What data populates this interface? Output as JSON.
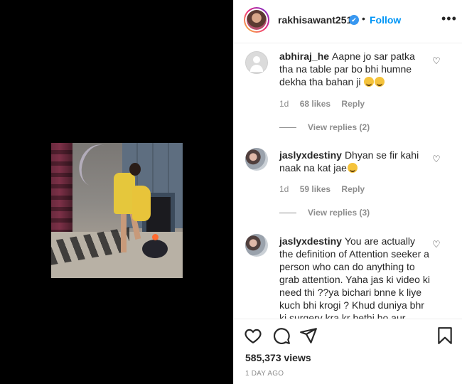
{
  "post": {
    "username": "rakhisawant2511",
    "verified_badge": "✔",
    "dot": "•",
    "follow_label": "Follow",
    "more_label": "•••"
  },
  "comments": [
    {
      "username": "abhiraj_he",
      "text": "Aapne jo sar patka tha na table par bo bhi humne dekha tha bahan ji",
      "age": "1d",
      "likes": "68 likes",
      "reply_label": "Reply",
      "view_replies": "View replies (2)"
    },
    {
      "username": "jaslyxdestiny",
      "text": "Dhyan se fir kahi naak na kat jae",
      "age": "1d",
      "likes": "59 likes",
      "reply_label": "Reply",
      "view_replies": "View replies (3)"
    },
    {
      "username": "jaslyxdestiny",
      "text": "You are actually the definition of Attention seeker a person who can do anything to grab attention. Yaha jas ki video ki need thi ??ya bichari bnne k liye kuch bhi krogi ? Khud duniya bhr ki surgery kra kr bethi ho aur"
    }
  ],
  "footer": {
    "views": "585,373 views",
    "date": "1 DAY AGO"
  },
  "icons": {
    "like": "heart-icon",
    "comment": "comment-icon",
    "share": "share-icon",
    "save": "bookmark-icon"
  },
  "colors": {
    "accent": "#0095f6",
    "verified": "#3897f0",
    "muted": "#8e8e8e",
    "media_bg": "#000000"
  }
}
